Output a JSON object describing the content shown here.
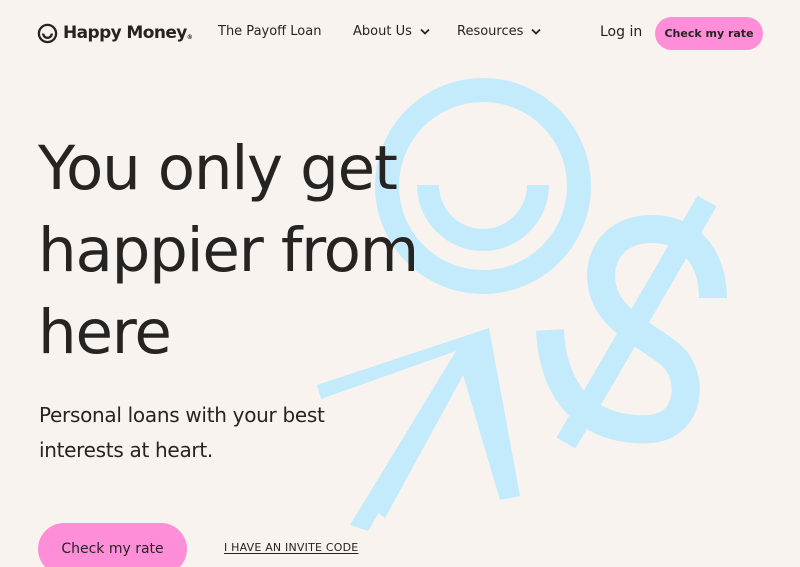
{
  "nav": {
    "logo_text": "Happy Money",
    "logo_reg": "®",
    "items": [
      {
        "label": "The Payoff Loan"
      },
      {
        "label": "About Us"
      },
      {
        "label": "Resources"
      }
    ],
    "login_label": "Log in",
    "cta_label": "Check my rate"
  },
  "hero": {
    "title": "You only get happier from here",
    "subtitle": "Personal loans with your best interests at heart.",
    "cta_label": "Check my rate",
    "invite_label": "I HAVE AN INVITE CODE"
  },
  "icons": {
    "logo": "smile-icon",
    "dropdown": "chevron-down-icon",
    "illustration": [
      "smile-circle-icon",
      "arrow-up-icon",
      "dollar-sign-icon"
    ]
  },
  "colors": {
    "background": "#f8f3ee",
    "text": "#262321",
    "accent_pink": "#ff8ed8",
    "illustration_blue": "#c3ebfc"
  }
}
